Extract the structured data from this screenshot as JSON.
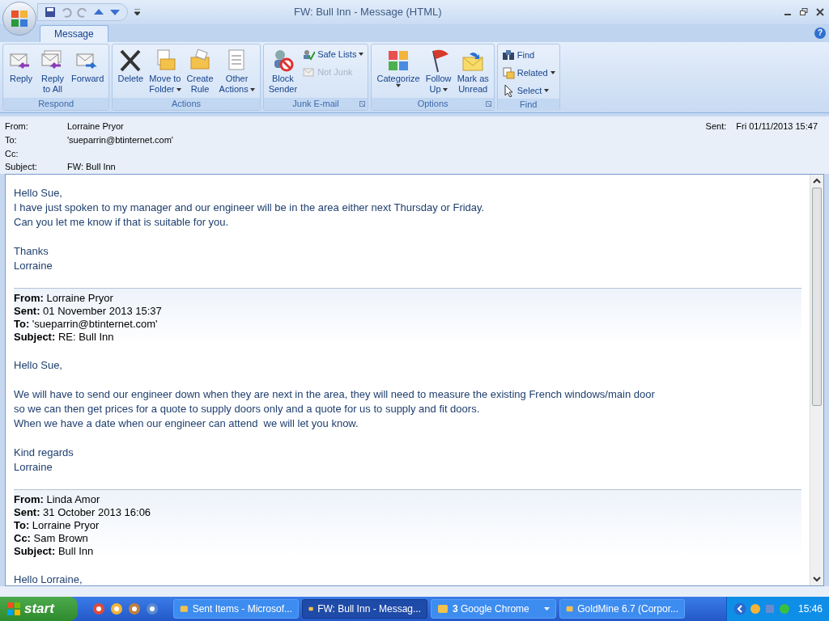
{
  "window": {
    "title": "FW: Bull Inn - Message (HTML)",
    "help": "?"
  },
  "tabs": [
    {
      "label": "Message",
      "selected": true
    }
  ],
  "ribbon": [
    {
      "label": "Respond",
      "buttons": [
        {
          "kind": "large",
          "lines": [
            "Reply"
          ]
        },
        {
          "kind": "large",
          "lines": [
            "Reply",
            "to All"
          ]
        },
        {
          "kind": "large",
          "lines": [
            "Forward"
          ]
        }
      ]
    },
    {
      "label": "Actions",
      "buttons": [
        {
          "kind": "large",
          "lines": [
            "Delete"
          ]
        },
        {
          "kind": "large",
          "lines": [
            "Move to",
            "Folder"
          ],
          "dropdown": true
        },
        {
          "kind": "large",
          "lines": [
            "Create",
            "Rule"
          ]
        },
        {
          "kind": "large",
          "lines": [
            "Other",
            "Actions"
          ],
          "dropdown": true
        }
      ]
    },
    {
      "label": "Junk E-mail",
      "launcher": true,
      "buttons": [
        {
          "kind": "large",
          "lines": [
            "Block",
            "Sender"
          ]
        },
        {
          "kind": "small",
          "lines": [
            "Safe Lists"
          ],
          "dropdown": true
        },
        {
          "kind": "small",
          "lines": [
            "Not Junk"
          ],
          "disabled": true
        }
      ]
    },
    {
      "label": "Options",
      "launcher": true,
      "buttons": [
        {
          "kind": "large",
          "lines": [
            "Categorize"
          ],
          "dropdown": true
        },
        {
          "kind": "large",
          "lines": [
            "Follow",
            "Up"
          ],
          "dropdown": true
        },
        {
          "kind": "large",
          "lines": [
            "Mark as",
            "Unread"
          ]
        }
      ]
    },
    {
      "label": "Find",
      "buttons": [
        {
          "kind": "small",
          "lines": [
            "Find"
          ]
        },
        {
          "kind": "small",
          "lines": [
            "Related"
          ],
          "dropdown": true
        },
        {
          "kind": "small",
          "lines": [
            "Select"
          ],
          "dropdown": true
        }
      ]
    }
  ],
  "header": {
    "fields": [
      {
        "label": "From:",
        "value": "Lorraine Pryor"
      },
      {
        "label": "To:",
        "value": "'sueparrin@btinternet.com'"
      },
      {
        "label": "Cc:"
      },
      {
        "label": "Subject:",
        "value": "FW: Bull Inn"
      }
    ],
    "sent": {
      "label": "Sent:",
      "value": "Fri 01/11/2013 15:47"
    }
  },
  "body": [
    {
      "kind": "para",
      "lines": [
        "Hello Sue,",
        "I have just spoken to my manager and our engineer will be in the area either next Thursday or Friday.",
        "Can you let me know if that is suitable for you."
      ]
    },
    {
      "kind": "para",
      "lines": [
        "Thanks",
        "Lorraine"
      ]
    },
    {
      "kind": "quote",
      "lines": [
        "**From:** Lorraine Pryor",
        "**Sent:** 01 November 2013 15:37",
        "**To:** 'sueparrin@btinternet.com'",
        "**Subject:** RE: Bull Inn"
      ]
    },
    {
      "kind": "para",
      "lines": [
        "Hello Sue,"
      ]
    },
    {
      "kind": "para",
      "lines": [
        "We will have to send our engineer down when they are next in the area, they will need to measure the existing French windows/main door",
        "so we can then get prices for a quote to supply doors only and a quote for us to supply and fit doors.",
        "When we have a date when our engineer can attend  we will let you know."
      ]
    },
    {
      "kind": "para",
      "lines": [
        "Kind regards",
        "Lorraine"
      ]
    },
    {
      "kind": "quote",
      "lines": [
        "**From:** Linda Amor",
        "**Sent:** 31 October 2013 16:06",
        "**To:** Lorraine Pryor",
        "**Cc:** Sam Brown",
        "**Subject:** Bull Inn"
      ]
    },
    {
      "kind": "para",
      "lines": [
        "Hello Lorraine,"
      ]
    }
  ],
  "taskbar": {
    "start": "start",
    "tasks": [
      {
        "label": "Sent Items - Microsof...",
        "selected": false
      },
      {
        "label": "FW: Bull Inn - Messag...",
        "selected": true
      },
      {
        "label": "**3** Google Chrome",
        "selected": false,
        "dropdown": true
      },
      {
        "label": "GoldMine 6.7 (Corpor...",
        "selected": false
      }
    ],
    "time": "15:46"
  }
}
